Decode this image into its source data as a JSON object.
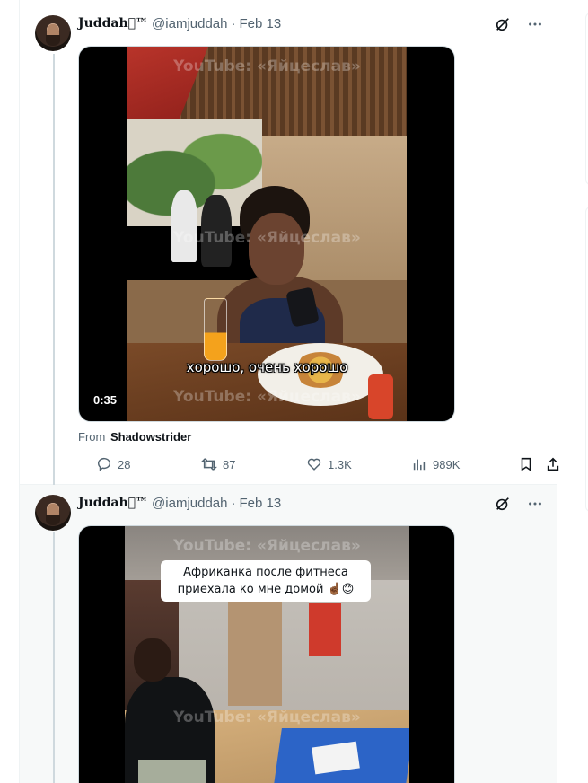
{
  "tweets": [
    {
      "display_name": "Juddah™",
      "handle": "@iamjuddah",
      "separator": "·",
      "date": "Feb 13",
      "video": {
        "duration": "0:35",
        "watermark_top": "YouTube: «Яйцеслав»",
        "watermark_mid": "YouTube: «Яйцеслав»",
        "watermark_bottom": "YouTube: «Яйцеслав»",
        "subtitle": "хорошо, очень хорошо"
      },
      "source_label": "From",
      "source_name": "Shadowstrider",
      "stats": {
        "replies": "28",
        "reposts": "87",
        "likes": "1.3K",
        "views": "989K"
      }
    },
    {
      "display_name": "Juddah™",
      "handle": "@iamjuddah",
      "separator": "·",
      "date": "Feb 13",
      "video": {
        "watermark_top": "YouTube: «Яйцеслав»",
        "watermark_mid": "YouTube: «Яйцеслав»",
        "caption_line1": "Африканка после фитнеса",
        "caption_line2": "приехала ко мне домой ☝🏾😊"
      }
    }
  ],
  "icons": {
    "grok": "grok-icon",
    "more": "more-icon",
    "reply": "reply-icon",
    "repost": "repost-icon",
    "like": "heart-icon",
    "views": "views-icon",
    "bookmark": "bookmark-icon",
    "share": "share-icon"
  },
  "colors": {
    "text_primary": "#0f1419",
    "text_secondary": "#536471",
    "border": "#eff3f4"
  }
}
